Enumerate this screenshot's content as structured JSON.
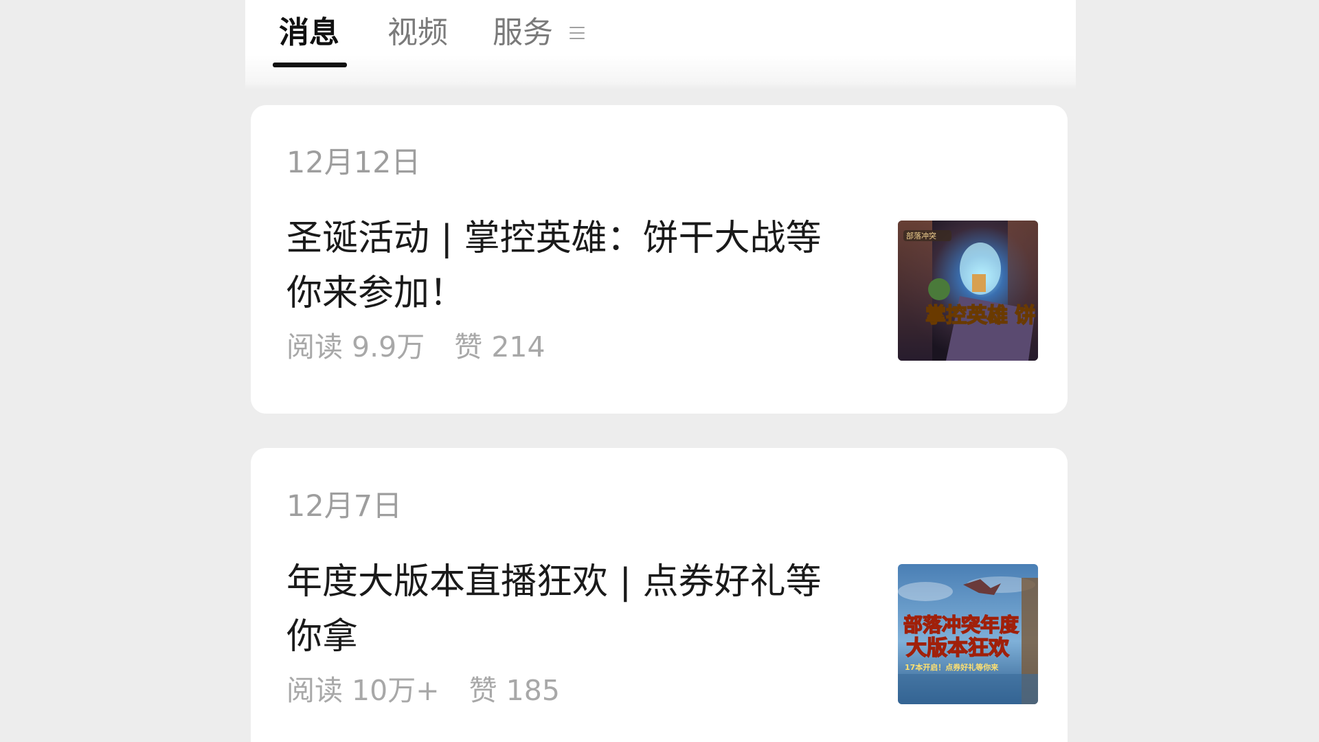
{
  "tabs": [
    {
      "label": "消息",
      "active": true
    },
    {
      "label": "视频",
      "active": false
    },
    {
      "label": "服务",
      "active": false
    }
  ],
  "menu_icon": "menu-icon",
  "articles": [
    {
      "date": "12月12日",
      "title_line1": "圣诞活动 | 掌控英雄：饼干大战等",
      "title_line2": "你来参加！",
      "reads": "阅读 9.9万",
      "likes": "赞 214",
      "thumbnail": {
        "badge": "部落冲突",
        "caption": "掌控英雄 饼"
      }
    },
    {
      "date": "12月7日",
      "title_line1": "年度大版本直播狂欢 | 点券好礼等",
      "title_line2": "你拿",
      "reads": "阅读 10万+",
      "likes": "赞 185",
      "thumbnail": {
        "caption_line1": "部落冲突年度",
        "caption_line2": "大版本狂欢",
        "caption_line3": "17本开启！点券好礼等你来"
      }
    }
  ],
  "colors": {
    "background": "#ededed",
    "card": "#ffffff",
    "title_text": "#1a1a1a",
    "meta_text": "#9e9e9e",
    "active_tab": "#111111",
    "inactive_tab": "#7a7a7a"
  }
}
